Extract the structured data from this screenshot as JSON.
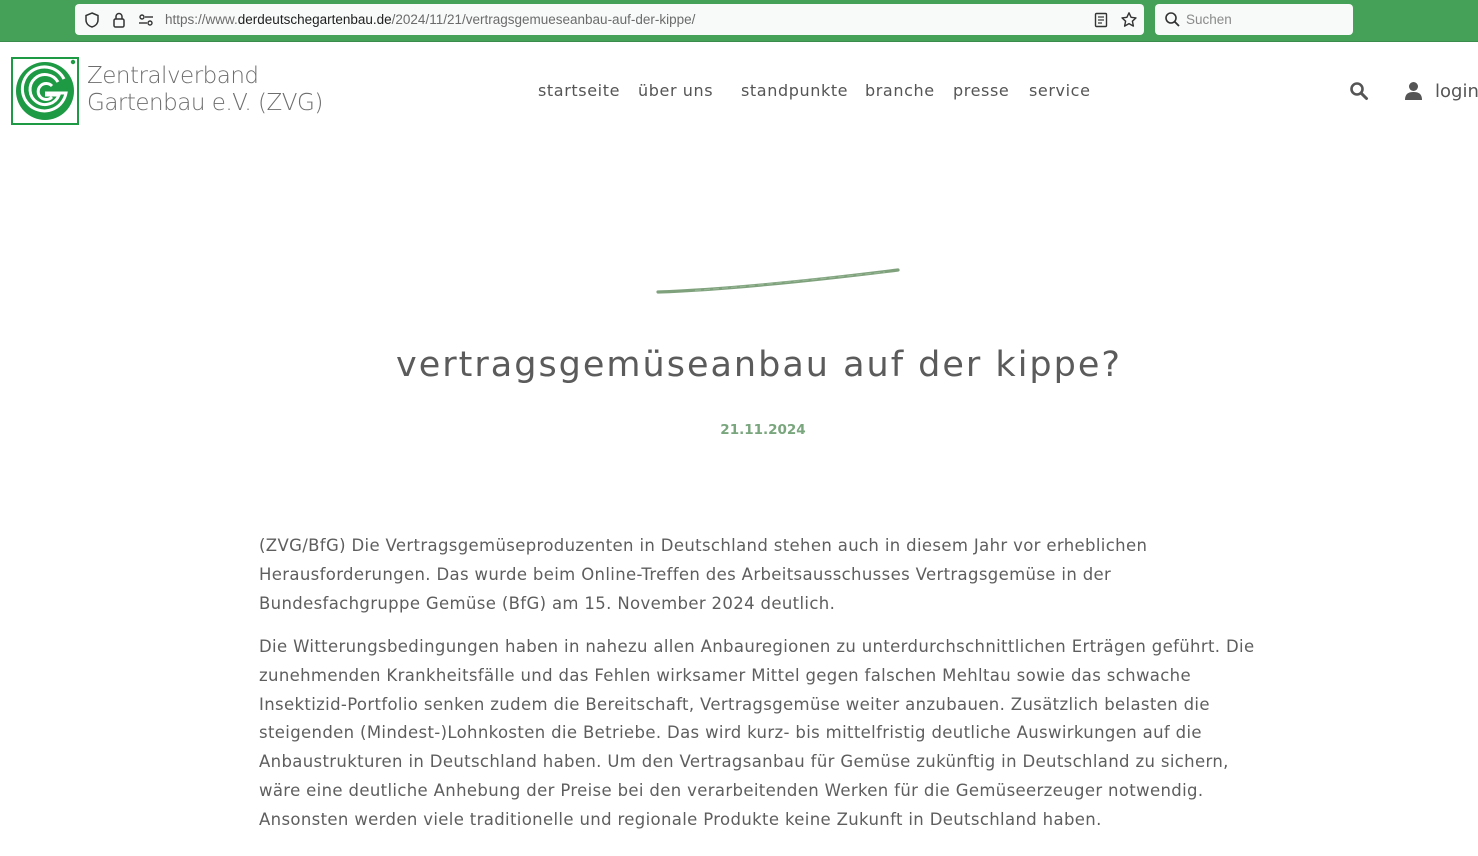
{
  "browser": {
    "url_prefix": "https://www.",
    "url_domain": "derdeutschegartenbau.de",
    "url_path": "/2024/11/21/vertragsgemueseanbau-auf-der-kippe/",
    "search_placeholder": "Suchen"
  },
  "header": {
    "brand_line1": "Zentralverband",
    "brand_line2": "Gartenbau e.V. (ZVG)",
    "nav": [
      {
        "label": "startseite"
      },
      {
        "label": "über uns"
      },
      {
        "label": "standpunkte"
      },
      {
        "label": "branche"
      },
      {
        "label": "presse"
      },
      {
        "label": "service"
      }
    ],
    "login_label": "login"
  },
  "article": {
    "title": "vertragsgemüseanbau auf der kippe?",
    "date": "21.11.2024",
    "paragraphs": [
      "(ZVG/BfG) Die Vertragsgemüseproduzenten in Deutschland stehen auch in diesem Jahr vor erheblichen Herausforderungen. Das wurde beim Online-Treffen des Arbeitsausschusses Vertragsgemüse in der Bundesfachgruppe Gemüse (BfG) am 15. November 2024 deutlich.",
      "Die Witterungsbedingungen haben in nahezu allen Anbauregionen zu unterdurchschnittlichen Erträgen geführt. Die zunehmenden Krankheitsfälle und das Fehlen wirksamer Mittel gegen falschen Mehltau sowie das schwache Insektizid-Portfolio senken zudem die Bereitschaft, Vertragsgemüse weiter anzubauen. Zusätzlich belasten die steigenden (Mindest-)Lohnkosten die Betriebe. Das wird kurz- bis mittelfristig deutliche Auswirkungen auf die Anbaustrukturen in Deutschland haben. Um den Vertragsanbau für Gemüse zukünftig in Deutschland zu sichern, wäre eine deutliche Anhebung der Preise bei den verarbeitenden Werken für die Gemüseerzeuger notwendig. Ansonsten werden viele traditionelle und regionale Produkte keine Zukunft in Deutschland haben."
    ]
  },
  "colors": {
    "browser_green": "#45a058",
    "brand_green": "#1e9a45",
    "date_green": "#79a67d",
    "stroke_green": "#7fa27d",
    "text_gray": "#5e5e5e"
  },
  "icons": [
    "shield-icon",
    "lock-icon",
    "permissions-icon",
    "reader-view-icon",
    "bookmark-star-icon",
    "search-icon",
    "user-icon",
    "zvg-logo-icon"
  ]
}
